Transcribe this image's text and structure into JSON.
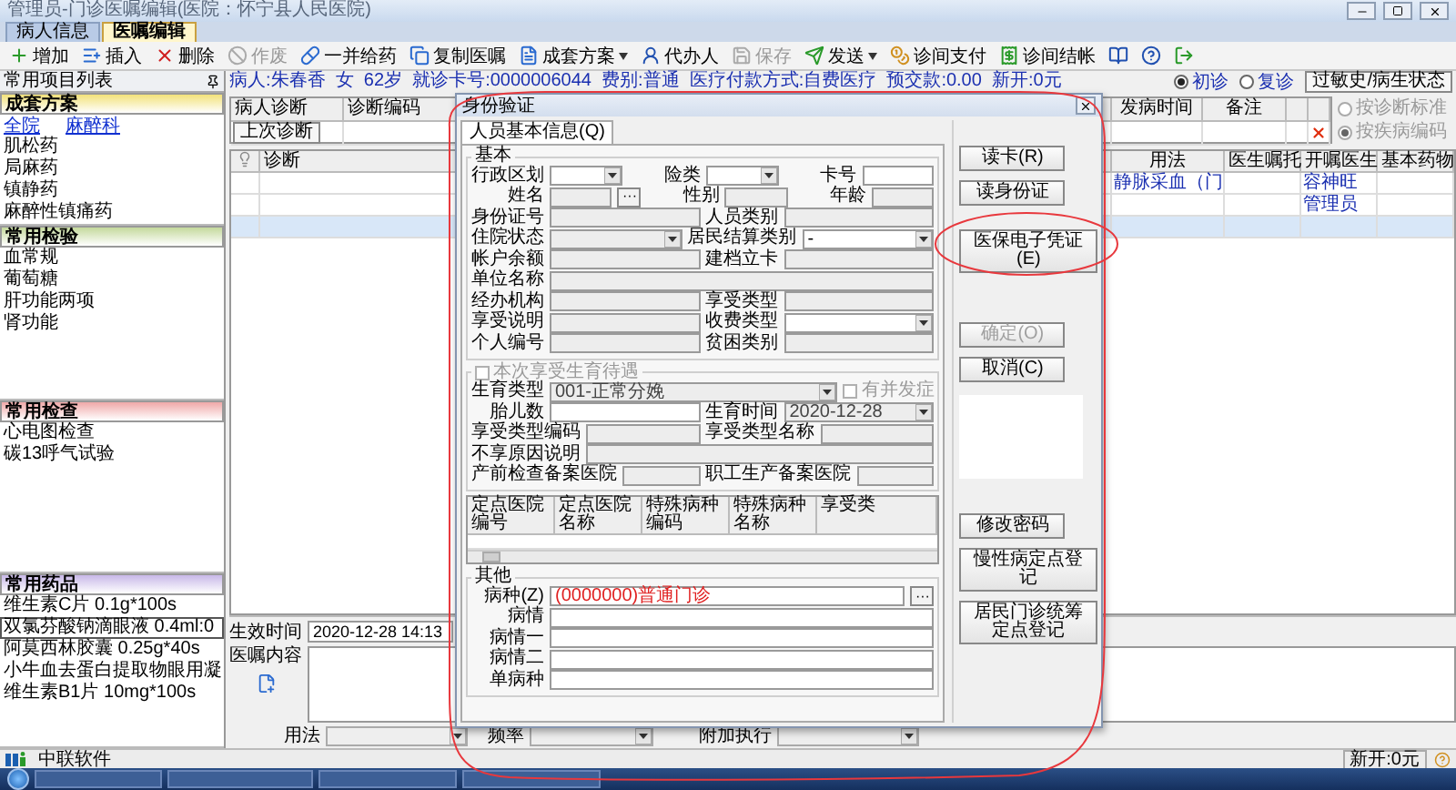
{
  "window": {
    "title": "管理员-门诊医嘱编辑(医院：怀宁县人民医院)"
  },
  "tabs": [
    {
      "label": "病人信息",
      "selected": false
    },
    {
      "label": "医嘱编辑",
      "selected": true
    }
  ],
  "toolbar": [
    {
      "label": "增加",
      "kind": "add",
      "disabled": false,
      "dropdown": false
    },
    {
      "label": "插入",
      "kind": "insert",
      "disabled": false,
      "dropdown": false
    },
    {
      "label": "删除",
      "kind": "delete",
      "disabled": false,
      "dropdown": false
    },
    {
      "label": "作废",
      "kind": "void",
      "disabled": true,
      "dropdown": false
    },
    {
      "label": "一并给药",
      "kind": "combine",
      "disabled": false,
      "dropdown": false
    },
    {
      "label": "复制医嘱",
      "kind": "copy",
      "disabled": false,
      "dropdown": false
    },
    {
      "label": "成套方案",
      "kind": "set",
      "disabled": false,
      "dropdown": true
    },
    {
      "label": "代办人",
      "kind": "agent",
      "disabled": false,
      "dropdown": false
    },
    {
      "label": "保存",
      "kind": "save",
      "disabled": true,
      "dropdown": false
    },
    {
      "label": "发送",
      "kind": "send",
      "disabled": false,
      "dropdown": true
    },
    {
      "label": "诊间支付",
      "kind": "pay",
      "disabled": false,
      "dropdown": false
    },
    {
      "label": "诊间结帐",
      "kind": "settle",
      "disabled": false,
      "dropdown": false
    },
    {
      "kind": "book",
      "disabled": false,
      "dropdown": false
    },
    {
      "kind": "help",
      "disabled": false,
      "dropdown": false
    },
    {
      "kind": "exit",
      "disabled": false,
      "dropdown": false
    }
  ],
  "left_panel": {
    "title": "常用项目列表",
    "sections": [
      {
        "title": "成套方案",
        "color": "#f2e27a",
        "links": [
          "全院",
          "麻醉科"
        ],
        "items": [
          {
            "label": "肌松药",
            "selected": false
          },
          {
            "label": "局麻药",
            "selected": false
          },
          {
            "label": "镇静药",
            "selected": false
          },
          {
            "label": "麻醉性镇痛药",
            "selected": false
          }
        ]
      },
      {
        "title": "常用检验",
        "color": "#c4d99c",
        "items": [
          {
            "label": "血常规",
            "selected": false
          },
          {
            "label": "葡萄糖",
            "selected": false
          },
          {
            "label": "肝功能两项",
            "selected": false
          },
          {
            "label": "肾功能",
            "selected": false
          }
        ]
      },
      {
        "title": "常用检查",
        "color": "#f0a8a8",
        "items": [
          {
            "label": "心电图检查",
            "selected": false
          },
          {
            "label": "碳13呼气试验",
            "selected": false
          }
        ]
      },
      {
        "title": "常用药品",
        "color": "#c8b8e8",
        "items": [
          {
            "label": "维生素C片 0.1g*100s",
            "selected": false
          },
          {
            "label": "双氯芬酸钠滴眼液 0.4ml:0",
            "selected": true
          },
          {
            "label": "阿莫西林胶囊 0.25g*40s",
            "selected": false
          },
          {
            "label": "小牛血去蛋白提取物眼用凝",
            "selected": false
          },
          {
            "label": "维生素B1片 10mg*100s",
            "selected": false
          }
        ]
      }
    ]
  },
  "patient_bar": {
    "info": "病人:朱春香  女  62岁  就诊卡号:0000006044  费别:普通  医疗付款方式:自费医疗  预交款:0.00  新开:0元",
    "visit_types": [
      {
        "label": "初诊",
        "selected": true
      },
      {
        "label": "复诊",
        "selected": false
      }
    ],
    "history_button": "过敏史/病生状态"
  },
  "diagnosis": {
    "columns": [
      "病人诊断",
      "诊断编码",
      "发病时间",
      "备注"
    ],
    "last_button": "上次诊断",
    "basis_disabled": true,
    "basis_options": [
      {
        "label": "按诊断标准",
        "selected": false
      },
      {
        "label": "按疾病编码",
        "selected": true
      }
    ]
  },
  "orders": {
    "columns": [
      "诊断",
      "用法",
      "医生嘱托",
      "开嘱医生",
      "基本药物"
    ],
    "rows": [
      {
        "usage": "静脉采血（门",
        "doctor": "容神旺",
        "selected": false
      },
      {
        "doctor": "管理员",
        "selected": false
      },
      {
        "selected": true
      }
    ]
  },
  "editor": {
    "effective_time_label": "生效时间",
    "effective_time": "2020-12-28 14:13",
    "content_label": "医嘱内容",
    "usage_label": "用法",
    "frequency_label": "频率",
    "extra_label": "附加执行"
  },
  "dialog": {
    "title": "身份验证",
    "tab": "人员基本信息(Q)",
    "basic": {
      "legend": "基本",
      "rows": [
        [
          {
            "label": "行政区划",
            "kind": "select",
            "disabled": false
          },
          {
            "label": "险类",
            "kind": "select",
            "disabled": false
          },
          {
            "label": "卡号",
            "kind": "input",
            "disabled": false
          }
        ],
        [
          {
            "label": "姓名",
            "kind": "input",
            "disabled": true,
            "browse": "···"
          },
          {
            "label": "性别",
            "kind": "input",
            "disabled": true
          },
          {
            "label": "年龄",
            "kind": "input",
            "disabled": true
          }
        ],
        [
          {
            "label": "身份证号",
            "kind": "input",
            "disabled": true
          },
          {
            "label": "人员类别",
            "kind": "input",
            "disabled": true
          }
        ],
        [
          {
            "label": "住院状态",
            "kind": "select",
            "disabled": true
          },
          {
            "label": "居民结算类别",
            "kind": "select",
            "disabled": false,
            "value": "-"
          }
        ],
        [
          {
            "label": "帐户余额",
            "kind": "input",
            "disabled": true
          },
          {
            "label": "建档立卡",
            "kind": "input",
            "disabled": true
          }
        ],
        [
          {
            "label": "单位名称",
            "kind": "input",
            "disabled": true
          }
        ],
        [
          {
            "label": "经办机构",
            "kind": "input",
            "disabled": true
          },
          {
            "label": "享受类型",
            "kind": "input",
            "disabled": true
          }
        ],
        [
          {
            "label": "享受说明",
            "kind": "input",
            "disabled": true
          },
          {
            "label": "收费类型",
            "kind": "select",
            "disabled": false
          }
        ],
        [
          {
            "label": "个人编号",
            "kind": "input",
            "disabled": true
          },
          {
            "label": "贫困类别",
            "kind": "input",
            "disabled": true
          }
        ]
      ]
    },
    "birth": {
      "legend": "本次享受生育待遇",
      "checked": false,
      "disabled": true,
      "rows": [
        [
          {
            "label": "生育类型",
            "kind": "select",
            "disabled": true,
            "value": "001-正常分娩"
          },
          {
            "label": "有并发症",
            "kind": "checkbox",
            "checked": false,
            "disabled": true
          }
        ],
        [
          {
            "label": "胎儿数",
            "kind": "input",
            "disabled": false
          },
          {
            "label": "生育时间",
            "kind": "select",
            "disabled": true,
            "value": "2020-12-28"
          }
        ],
        [
          {
            "label": "享受类型编码",
            "kind": "input",
            "disabled": true
          },
          {
            "label": "享受类型名称",
            "kind": "input",
            "disabled": true
          }
        ],
        [
          {
            "label": "不享原因说明",
            "kind": "input",
            "disabled": true
          }
        ],
        [
          {
            "label": "产前检查备案医院",
            "kind": "input",
            "disabled": true
          },
          {
            "label": "职工生产备案医院",
            "kind": "input",
            "disabled": true
          }
        ]
      ]
    },
    "table": {
      "columns": [
        "定点医院编号",
        "定点医院名称",
        "特殊病种编码",
        "特殊病种名称",
        "享受类"
      ]
    },
    "other": {
      "legend": "其他",
      "rows": [
        [
          {
            "label": "病种(Z)",
            "kind": "input",
            "disabled": false,
            "highlight": true,
            "value": "(0000000)普通门诊",
            "browse": "···"
          }
        ],
        [
          {
            "label": "病情",
            "kind": "input",
            "disabled": false
          }
        ],
        [
          {
            "label": "病情一",
            "kind": "input",
            "disabled": false
          }
        ],
        [
          {
            "label": "病情二",
            "kind": "input",
            "disabled": false
          }
        ],
        [
          {
            "label": "单病种",
            "kind": "input",
            "disabled": false
          }
        ]
      ]
    },
    "read_buttons": [
      {
        "label": "读卡(R)",
        "disabled": false
      },
      {
        "label": "读身份证",
        "disabled": false
      },
      {
        "label": "医保电子凭证(E)",
        "disabled": false
      }
    ],
    "confirm_buttons": [
      {
        "label": "确定(O)",
        "disabled": true
      },
      {
        "label": "取消(C)",
        "disabled": false
      }
    ],
    "register_buttons": [
      {
        "label": "修改密码",
        "disabled": false
      },
      {
        "label": "慢性病定点登记",
        "disabled": false
      },
      {
        "label": "居民门诊统筹定点登记",
        "disabled": false
      }
    ]
  },
  "status_bar": {
    "company": "中联软件",
    "new_amount": "新开:0元"
  }
}
